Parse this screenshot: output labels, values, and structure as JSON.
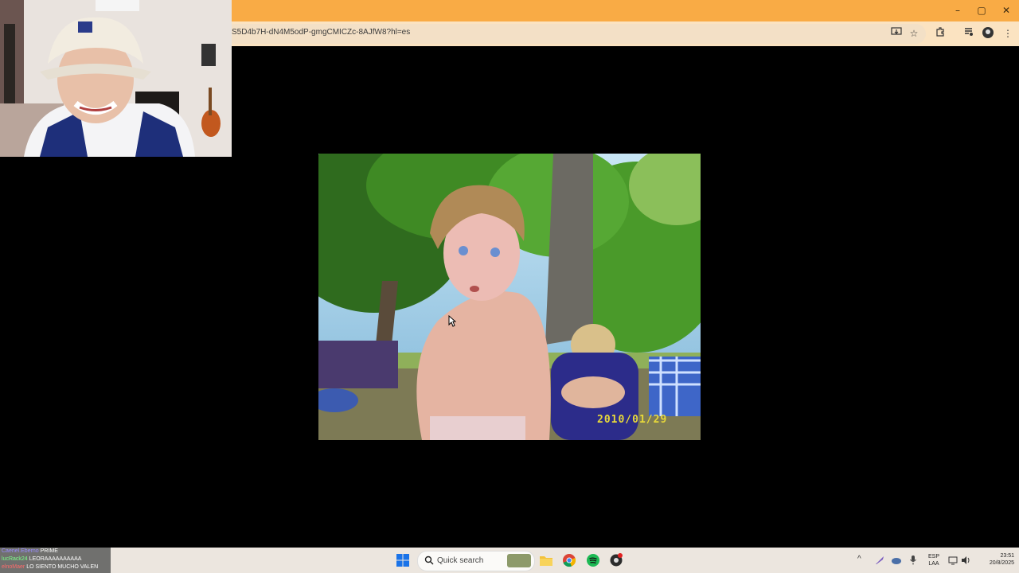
{
  "browser": {
    "url": "S5D4b7H-dN4M5odP-gmgCMICZc-8AJfW8?hl=es",
    "window_controls": {
      "minimize": "–",
      "maximize": "▢",
      "close": "✕"
    },
    "toolbar_icons": [
      "install-icon",
      "star-icon",
      "extensions-icon",
      "media-icon",
      "profile-icon",
      "menu-icon"
    ]
  },
  "photo": {
    "date_stamp": "2010/01/29"
  },
  "chat": [
    {
      "user": "Caenel.Eberno",
      "message": "PRIME"
    },
    {
      "user": "lucRack24",
      "message": "LEORAAAAAAAAAA"
    },
    {
      "user": "elnoMaer",
      "message": "LO SIENTO MUCHO VALEN"
    }
  ],
  "taskbar": {
    "search_placeholder": "Quick search",
    "language": "ESP",
    "layout": "LAA",
    "time": "23:51",
    "date": "20/8/2025"
  },
  "colors": {
    "titlebar": "#f9ab45",
    "addressbar": "#fbe3c1",
    "taskbar": "#ece6df",
    "date_stamp": "#e8d93a"
  }
}
